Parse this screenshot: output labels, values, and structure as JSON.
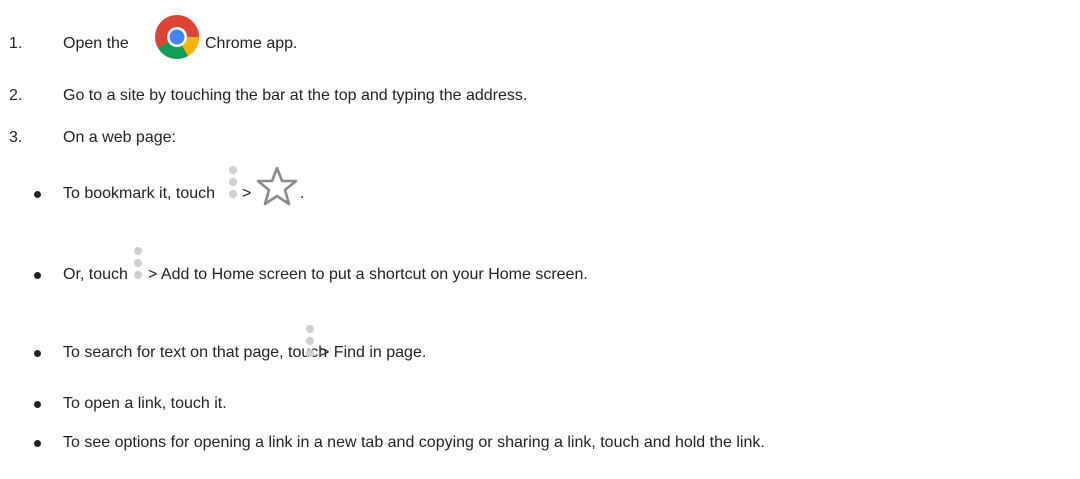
{
  "steps": [
    {
      "number": "1.",
      "before": "Open the",
      "icon": "chrome-icon",
      "after": "Chrome app."
    },
    {
      "number": "2.",
      "text": "Go to a site by touching the bar at the top and typing the address."
    },
    {
      "number": "3.",
      "text": "On a web page:"
    }
  ],
  "bullets": [
    {
      "before": "To bookmark it, touch",
      "more_icon": "more-vert-icon",
      "sep": ">",
      "star_icon": "star-outline-icon",
      "after": "."
    },
    {
      "before": "Or, touch",
      "more_icon": "more-vert-icon",
      "after": "> Add to Home screen to put a shortcut on your Home screen."
    },
    {
      "before": "To search for text on that page, touch",
      "more_icon": "more-vert-icon",
      "after": "> Find in page."
    },
    {
      "text": "To open a link, touch it."
    },
    {
      "text": "To see options for opening a link in a new tab and copying or sharing a link, touch and hold the link."
    }
  ]
}
